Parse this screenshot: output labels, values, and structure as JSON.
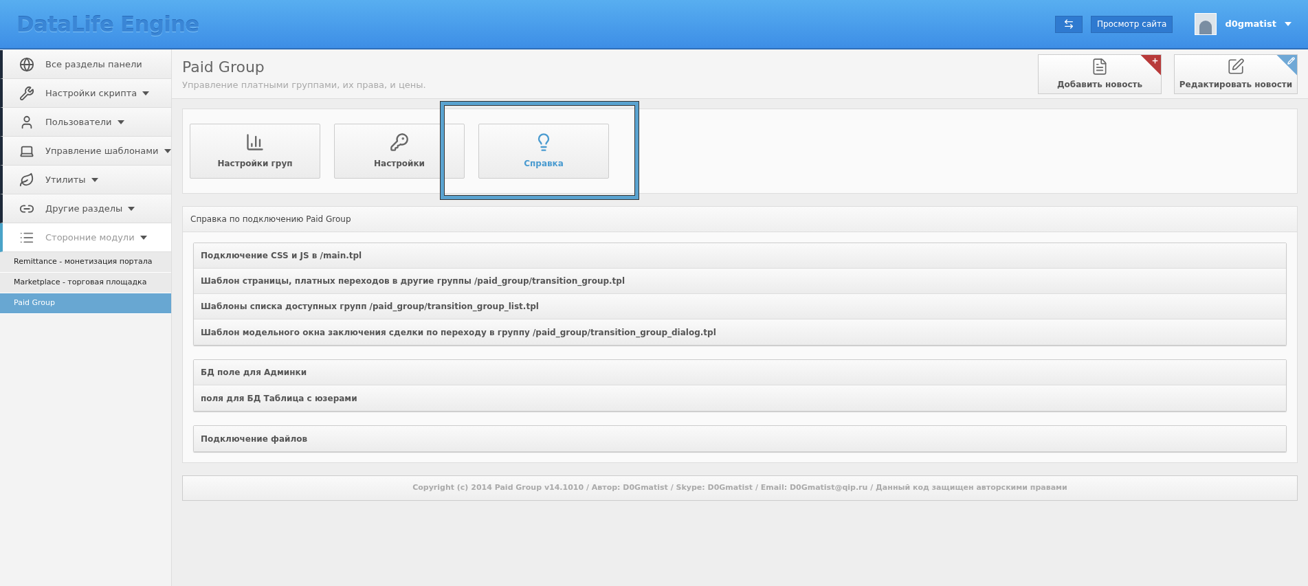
{
  "header": {
    "logo": "DataLife Engine",
    "view_site": "Просмотр сайта",
    "username": "d0gmatist"
  },
  "sidebar": {
    "items": [
      {
        "label": "Все разделы панели",
        "has_caret": false,
        "expanded": false
      },
      {
        "label": "Настройки скрипта",
        "has_caret": true,
        "expanded": false
      },
      {
        "label": "Пользователи",
        "has_caret": true,
        "expanded": false
      },
      {
        "label": "Управление шаблонами",
        "has_caret": true,
        "expanded": false
      },
      {
        "label": "Утилиты",
        "has_caret": true,
        "expanded": false
      },
      {
        "label": "Другие разделы",
        "has_caret": true,
        "expanded": false
      },
      {
        "label": "Сторонние модули",
        "has_caret": true,
        "expanded": true,
        "children": [
          {
            "label": "Remittance - монетизация портала",
            "selected": false
          },
          {
            "label": "Marketplace - торговая площадка",
            "selected": false
          },
          {
            "label": "Paid Group",
            "selected": true
          }
        ]
      }
    ]
  },
  "page": {
    "title": "Paid Group",
    "subtitle": "Управление платными группами, их права, и цены.",
    "quick_actions": [
      {
        "label": "Добавить новость",
        "color": "#b83a3a"
      },
      {
        "label": "Редактировать новости",
        "color": "#6fa8d6"
      }
    ]
  },
  "module_buttons": [
    {
      "label": "Настройки груп",
      "selected": false,
      "highlighted": false
    },
    {
      "label": "Настройки",
      "selected": false,
      "highlighted": false
    },
    {
      "label": "Справка",
      "selected": true,
      "highlighted": true
    }
  ],
  "help_panel": {
    "title": "Справка по подключению Paid Group",
    "groups": [
      [
        "Подключение CSS и JS в /main.tpl",
        "Шаблон страницы, платных переходов в другие группы /paid_group/transition_group.tpl",
        "Шаблоны списка доступных групп /paid_group/transition_group_list.tpl",
        "Шаблон модельного окна заключения сделки по переходу в группу /paid_group/transition_group_dialog.tpl"
      ],
      [
        "БД поле для Админки",
        "поля для БД Таблица с юзерами"
      ],
      [
        "Подключение файлов"
      ]
    ]
  },
  "footer": "Copyright (c) 2014 Paid Group v14.1010 / Автор: D0Gmatist / Skype: D0Gmatist / Email: D0Gmatist@qip.ru / Данный код защищен авторскими правами"
}
